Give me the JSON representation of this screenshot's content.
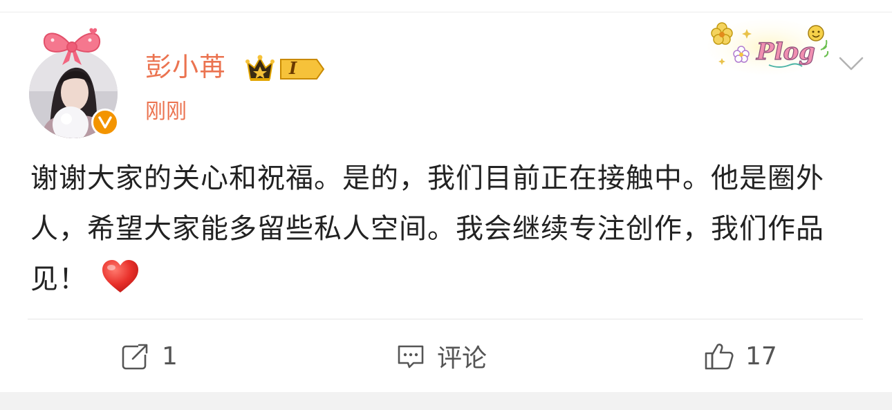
{
  "post": {
    "author": "彭小苒",
    "vip_level": "I",
    "time": "刚刚",
    "text": "谢谢大家的关心和祝福。是的，我们目前正在接触中。他是圈外人，希望大家能多留些私人空间。我会继续专注创作，我们作品见！",
    "emoji": "heart-emoji",
    "sticker_text": "Plog",
    "avatar_badge": "verified-v-icon"
  },
  "actions": {
    "repost": {
      "icon": "repost-icon",
      "label": "1"
    },
    "comment": {
      "icon": "comment-icon",
      "label": "评论"
    },
    "like": {
      "icon": "thumbs-up-icon",
      "label": "17"
    }
  },
  "colors": {
    "username": "#eb7350",
    "badge": "#f39400",
    "heart": "#e8302a",
    "text": "#222222",
    "action_text": "#555555"
  }
}
